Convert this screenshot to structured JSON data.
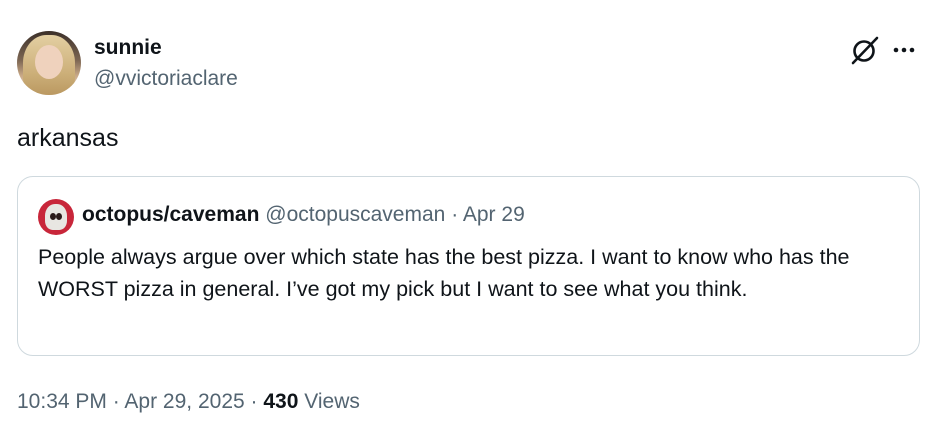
{
  "author": {
    "name": "sunnie",
    "handle": "@vvictoriaclare"
  },
  "tweet": {
    "text": "arkansas"
  },
  "quoted_tweet": {
    "name": "octopus/caveman",
    "handle": "@octopuscaveman",
    "separator": "·",
    "date": "Apr 29",
    "text": "People always argue over which state has the best pizza. I want to know who has the WORST pizza in general. I’ve got my pick but I want to see what you think."
  },
  "footer": {
    "time": "10:34 PM",
    "separator1": "·",
    "date": "Apr 29, 2025",
    "separator2": "·",
    "views_count": "430",
    "views_label": "Views"
  },
  "icons": {
    "grok": "grok-icon",
    "more": "more-icon"
  },
  "colors": {
    "text": "#0f1419",
    "secondary": "#536471",
    "border": "#cfd9de"
  }
}
